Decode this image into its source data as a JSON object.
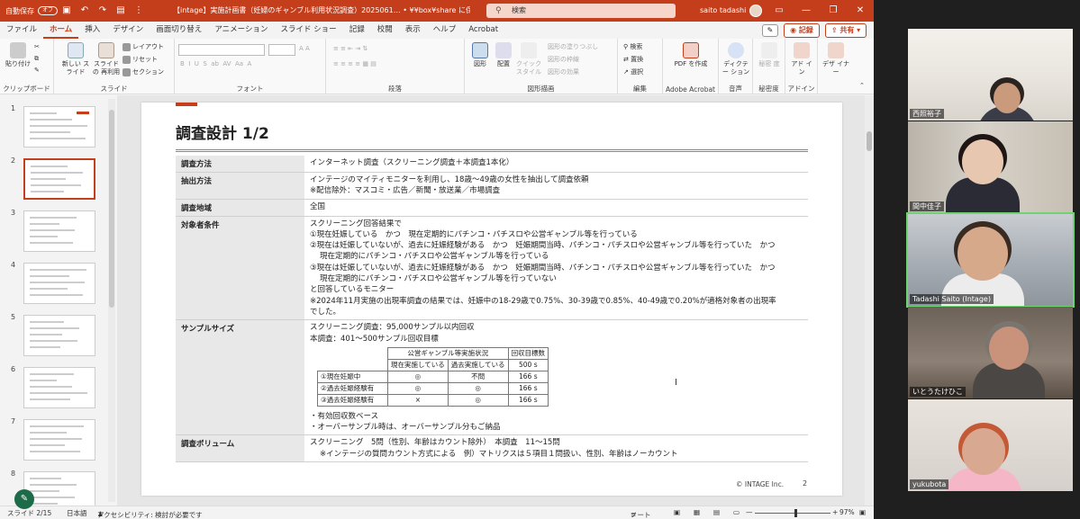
{
  "titlebar": {
    "autosave_label": "自動保存",
    "autosave_state": "オフ",
    "document_title": "【intage】実施計画書（妊婦のギャンブル利用状況調査）2025061… • ¥¥box¥share に保存済み ∨",
    "search_placeholder": "検索",
    "user_name": "saito tadashi"
  },
  "tabs": [
    "ファイル",
    "ホーム",
    "挿入",
    "デザイン",
    "画面切り替え",
    "アニメーション",
    "スライド ショー",
    "記録",
    "校閲",
    "表示",
    "ヘルプ",
    "Acrobat"
  ],
  "active_tab": "ホーム",
  "toolbar_right": {
    "record_label": "記録",
    "share_label": "共有"
  },
  "ribbon": {
    "clipboard": {
      "label": "クリップボード",
      "paste": "貼り付け"
    },
    "slides": {
      "label": "スライド",
      "new_slide": "新しい スライド",
      "reuse_slide": "スライドの 再利用",
      "layout": "レイアウト",
      "reset": "リセット",
      "section": "セクション"
    },
    "font": {
      "label": "フォント"
    },
    "paragraph": {
      "label": "段落"
    },
    "drawing": {
      "label": "図形描画",
      "shapes": "図形",
      "arrange": "配置",
      "quick_styles": "クイック スタイル",
      "shape_fill": "図形の塗りつぶし",
      "shape_outline": "図形の枠線",
      "shape_effects": "図形の効果"
    },
    "editing": {
      "label": "編集",
      "find": "検索",
      "replace": "置換",
      "select": "選択"
    },
    "acrobat": {
      "label": "Adobe Acrobat",
      "pdf": "PDF を作成"
    },
    "voice": {
      "label": "音声",
      "dictate": "ディクテー ション"
    },
    "sensitivity": {
      "label": "秘密度",
      "btn": "秘密 度"
    },
    "addins": {
      "label": "アドイン",
      "btn": "アド イン"
    },
    "designer": {
      "btn": "デザ イナー"
    }
  },
  "thumbnails": [
    "1",
    "2",
    "3",
    "4",
    "5",
    "6",
    "7",
    "8"
  ],
  "selected_slide_index": 1,
  "slide": {
    "title": "調査設計 1/2",
    "rows": [
      {
        "label": "調査方法",
        "lines": [
          "インターネット調査（スクリーニング調査＋本調査1本化）"
        ]
      },
      {
        "label": "抽出方法",
        "lines": [
          "インテージのマイティモニターを利用し、18歳～49歳の女性を抽出して調査依頼",
          "※配信除外：マスコミ・広告／新聞・放送業／市場調査"
        ]
      },
      {
        "label": "調査地域",
        "lines": [
          "全国"
        ]
      },
      {
        "label": "対象者条件",
        "lines": [
          "スクリーニング回答結果で",
          "①現在妊娠している　かつ　現在定期的にパチンコ・パチスロや公営ギャンブル等を行っている",
          "②現在は妊娠していないが、過去に妊娠経験がある　かつ　妊娠期間当時、パチンコ・パチスロや公営ギャンブル等を行っていた　かつ",
          "現在定期的にパチンコ・パチスロや公営ギャンブル等を行っている",
          "③現在は妊娠していないが、過去に妊娠経験がある　かつ　妊娠期間当時、パチンコ・パチスロや公営ギャンブル等を行っていた　かつ",
          "現在定期的にパチンコ・パチスロや公営ギャンブル等を行っていない",
          "と回答しているモニター",
          "※2024年11月実施の出現率調査の結果では、妊娠中の18-29歳で0.75%、30-39歳で0.85%、40-49歳で0.20%が適格対象者の出現率",
          "でした。"
        ]
      },
      {
        "label": "サンプルサイズ",
        "lines": [
          "スクリーニング調査：95,000サンプル以内回収",
          "本調査：401～500サンプル回収目標"
        ],
        "notes": [
          "・有効回収数ベース",
          "・オーバーサンプル時は、オーバーサンプル分もご納品"
        ]
      },
      {
        "label": "調査ボリューム",
        "lines": [
          "スクリーニング　5問（性別、年齢はカウント除外）　本調査　11～15問",
          "※インテージの質問カウント方式による　例）マトリクスは５項目１問扱い、性別、年齢はノーカウント"
        ]
      }
    ],
    "quota": {
      "group_header": "公営ギャンブル等実施状況",
      "target_header": "回収目標数",
      "sub_current": "現在実施している",
      "sub_past": "過去実施している",
      "total": "500 s",
      "rows": [
        {
          "label": "①現在妊娠中",
          "current": "◎",
          "past": "不問",
          "target": "166 s"
        },
        {
          "label": "②過去妊娠経験有",
          "current": "◎",
          "past": "◎",
          "target": "166 s"
        },
        {
          "label": "③過去妊娠経験有",
          "current": "×",
          "past": "◎",
          "target": "166 s"
        }
      ]
    },
    "footer_brand": "© INTAGE Inc.",
    "page_number": "2"
  },
  "statusbar": {
    "slide_pos": "スライド 2/15",
    "language": "日本語",
    "accessibility": "アクセシビリティ: 検討が必要です",
    "notes": "ノート",
    "zoom": "97%",
    "zoom_fraction": 0.52
  },
  "participants": [
    {
      "name": "西照裕子"
    },
    {
      "name": "間中佳子"
    },
    {
      "name": "Tadashi Saito (Intage)"
    },
    {
      "name": "いとうたけひこ"
    },
    {
      "name": "yukubota"
    }
  ],
  "active_participant_index": 2,
  "colors": {
    "accent": "#c43e1c",
    "active_speaker": "#6fd36f"
  }
}
